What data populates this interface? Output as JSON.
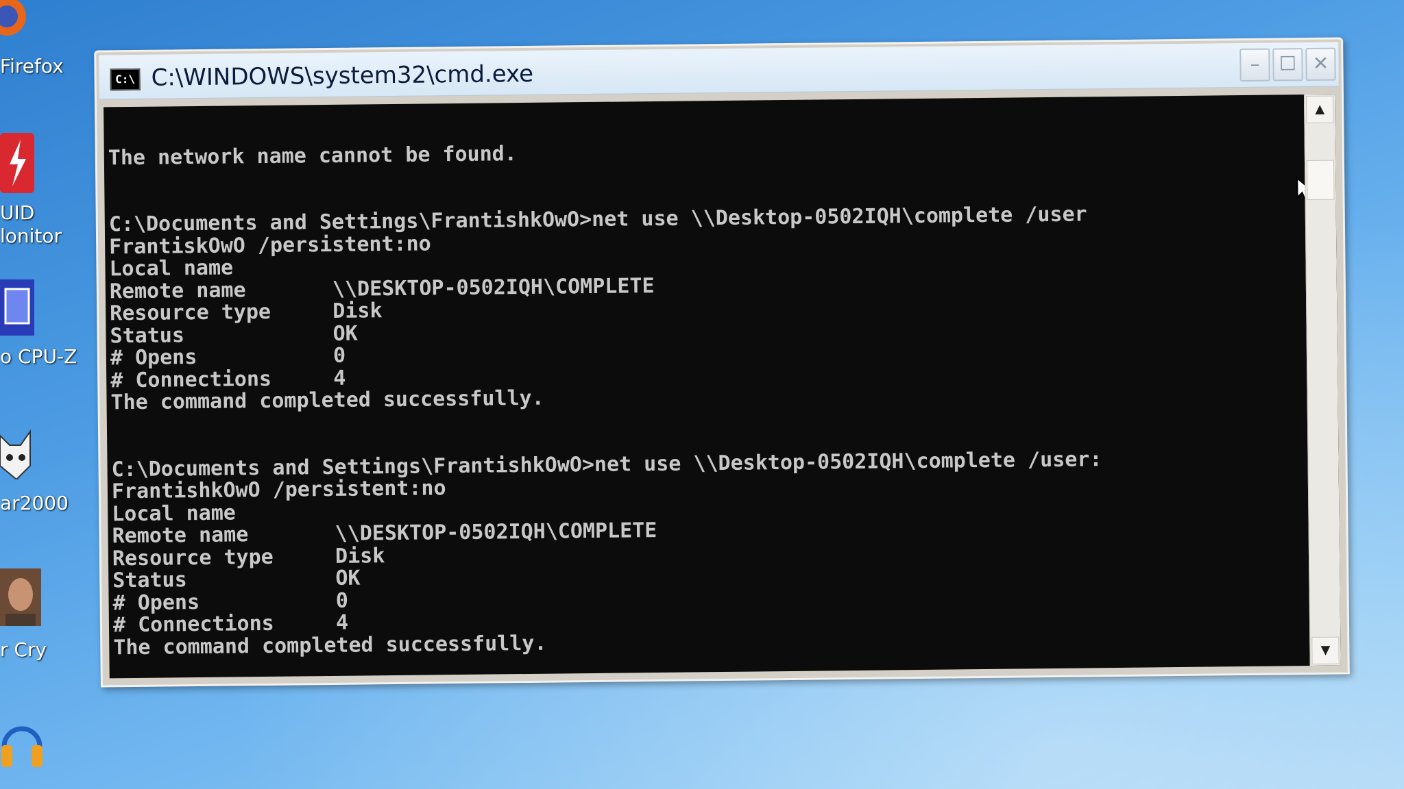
{
  "window": {
    "title": "C:\\WINDOWS\\system32\\cmd.exe",
    "icon_text": "C:\\",
    "controls": {
      "minimize": "–",
      "maximize": "☐",
      "close": "✕"
    }
  },
  "console": {
    "lines": [
      "",
      "The network name cannot be found.",
      "",
      "",
      "C:\\Documents and Settings\\FrantishkOwO>net use \\\\Desktop-0502IQH\\complete /user",
      "FrantiskOwO /persistent:no",
      "Local name",
      "Remote name       \\\\DESKTOP-0502IQH\\COMPLETE",
      "Resource type     Disk",
      "Status            OK",
      "# Opens           0",
      "# Connections     4",
      "The command completed successfully.",
      "",
      "",
      "C:\\Documents and Settings\\FrantishkOwO>net use \\\\Desktop-0502IQH\\complete /user:",
      "FrantishkOwO /persistent:no",
      "Local name",
      "Remote name       \\\\DESKTOP-0502IQH\\COMPLETE",
      "Resource type     Disk",
      "Status            OK",
      "# Opens           0",
      "# Connections     4",
      "The command completed successfully."
    ]
  },
  "scrollbar": {
    "up_arrow": "▲",
    "down_arrow": "▼"
  },
  "desktop": {
    "icons": [
      {
        "name": "firefox-icon",
        "label": "Firefox",
        "color": "#e8661a"
      },
      {
        "name": "hwmonitor-icon",
        "label": "UID\nlonitor",
        "color": "#d9282f"
      },
      {
        "name": "cpuz-icon",
        "label": "o CPU-Z",
        "color": "#3a4fd1"
      },
      {
        "name": "cat-icon",
        "label": "ar2000",
        "color": "#f2f2f2"
      },
      {
        "name": "farcry-icon",
        "label": "r Cry",
        "color": "#b07a52"
      },
      {
        "name": "audacity-icon",
        "label": "",
        "color": "#f0a020"
      }
    ]
  }
}
